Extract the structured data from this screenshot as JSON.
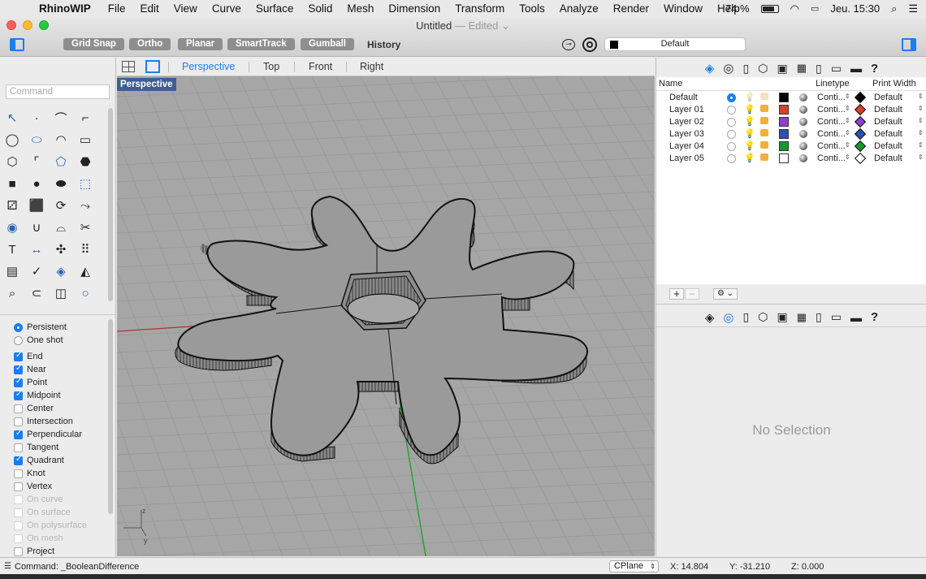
{
  "menubar": {
    "app_name": "RhinoWIP",
    "items": [
      "File",
      "Edit",
      "View",
      "Curve",
      "Surface",
      "Solid",
      "Mesh",
      "Dimension",
      "Transform",
      "Tools",
      "Analyze",
      "Render",
      "Window",
      "Help"
    ],
    "battery": "74 %",
    "clock": "Jeu. 15:30"
  },
  "window": {
    "title": "Untitled",
    "edited": "— Edited"
  },
  "toolbar": {
    "buttons": [
      "Grid Snap",
      "Ortho",
      "Planar",
      "SmartTrack",
      "Gumball"
    ],
    "history": "History",
    "current_layer": "Default"
  },
  "sidebar": {
    "command_placeholder": "Command",
    "osnap_modes": [
      {
        "label": "Persistent",
        "type": "radio",
        "checked": true,
        "enabled": true
      },
      {
        "label": "One shot",
        "type": "radio",
        "checked": false,
        "enabled": true
      }
    ],
    "osnaps": [
      {
        "label": "End",
        "checked": true,
        "enabled": true
      },
      {
        "label": "Near",
        "checked": true,
        "enabled": true
      },
      {
        "label": "Point",
        "checked": true,
        "enabled": true
      },
      {
        "label": "Midpoint",
        "checked": true,
        "enabled": true
      },
      {
        "label": "Center",
        "checked": false,
        "enabled": true
      },
      {
        "label": "Intersection",
        "checked": false,
        "enabled": true
      },
      {
        "label": "Perpendicular",
        "checked": true,
        "enabled": true
      },
      {
        "label": "Tangent",
        "checked": false,
        "enabled": true
      },
      {
        "label": "Quadrant",
        "checked": true,
        "enabled": true
      },
      {
        "label": "Knot",
        "checked": false,
        "enabled": true
      },
      {
        "label": "Vertex",
        "checked": false,
        "enabled": true
      },
      {
        "label": "On curve",
        "checked": false,
        "enabled": false
      },
      {
        "label": "On surface",
        "checked": false,
        "enabled": false
      },
      {
        "label": "On polysurface",
        "checked": false,
        "enabled": false
      },
      {
        "label": "On mesh",
        "checked": false,
        "enabled": false
      },
      {
        "label": "Project",
        "checked": false,
        "enabled": true
      }
    ]
  },
  "viewport": {
    "tabs": [
      "Perspective",
      "Top",
      "Front",
      "Right"
    ],
    "active_tab": "Perspective",
    "label": "Perspective"
  },
  "layers": {
    "columns": {
      "name": "Name",
      "linetype": "Linetype",
      "print_width": "Print Width"
    },
    "rows": [
      {
        "name": "Default",
        "current": true,
        "color": "#000000",
        "linetype": "Conti...",
        "print_color": "#000000",
        "print_width": "Default"
      },
      {
        "name": "Layer 01",
        "current": false,
        "color": "#d9402b",
        "linetype": "Conti...",
        "print_color": "#d9402b",
        "print_width": "Default"
      },
      {
        "name": "Layer 02",
        "current": false,
        "color": "#8e3fcf",
        "linetype": "Conti...",
        "print_color": "#8e3fcf",
        "print_width": "Default"
      },
      {
        "name": "Layer 03",
        "current": false,
        "color": "#2e4fb3",
        "linetype": "Conti...",
        "print_color": "#2e4fb3",
        "print_width": "Default"
      },
      {
        "name": "Layer 04",
        "current": false,
        "color": "#159a2a",
        "linetype": "Conti...",
        "print_color": "#159a2a",
        "print_width": "Default"
      },
      {
        "name": "Layer 05",
        "current": false,
        "color": "#ffffff",
        "linetype": "Conti...",
        "print_color": "#ffffff",
        "print_width": "Default"
      }
    ]
  },
  "properties": {
    "empty_text": "No Selection"
  },
  "statusbar": {
    "command": "Command: _BooleanDifference",
    "cplane": "CPlane",
    "x": "X: 14.804",
    "y": "Y: -31.210",
    "z": "Z: 0.000"
  },
  "axis_labels": {
    "z": "z",
    "y": "y"
  }
}
